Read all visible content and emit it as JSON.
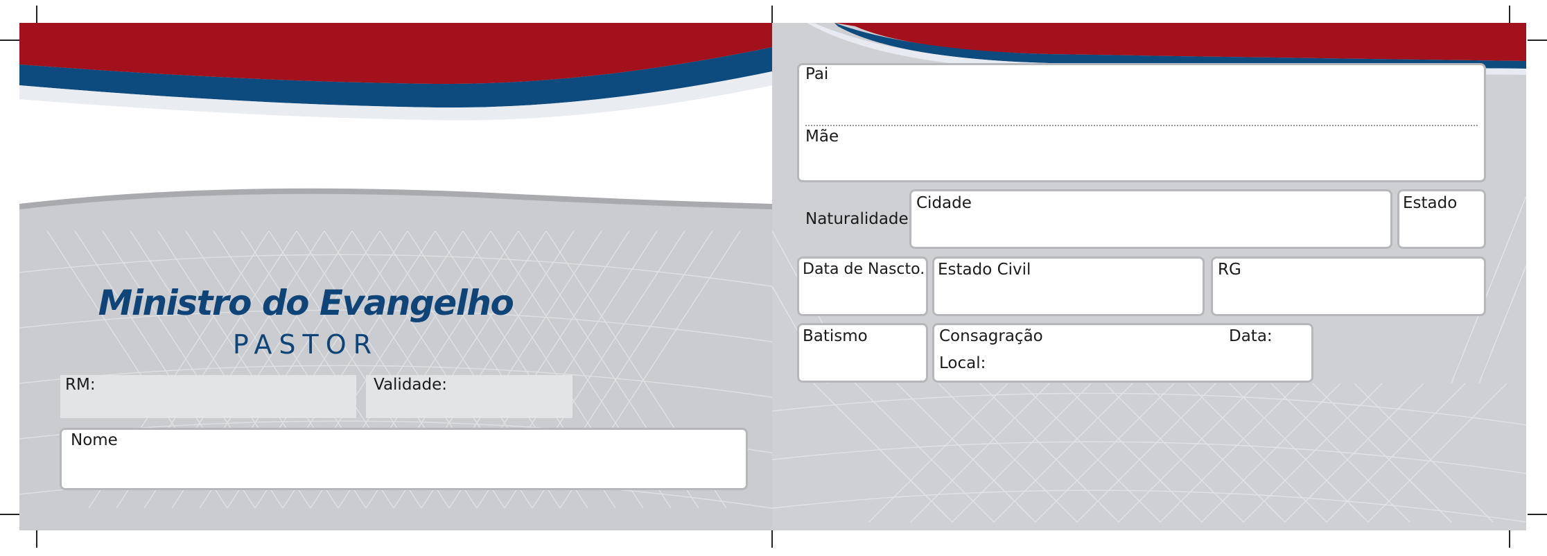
{
  "front": {
    "title": "Ministro do Evangelho",
    "subtitle": "PASTOR",
    "rm_label": "RM:",
    "validade_label": "Validade:",
    "nome_label": "Nome"
  },
  "back": {
    "pai_label": "Pai",
    "mae_label": "Mãe",
    "naturalidade_label": "Naturalidade",
    "cidade_label": "Cidade",
    "estado_label": "Estado",
    "data_nasc_label": "Data de Nascto.",
    "estado_civil_label": "Estado Civil",
    "rg_label": "RG",
    "batismo_label": "Batismo",
    "consagracao_label": "Consagração",
    "data_label": "Data:",
    "local_label": "Local:"
  },
  "colors": {
    "red": "#a3121c",
    "blue": "#0d4a7e",
    "title_blue": "#0f4478",
    "panel_grey": "#cbcccf"
  }
}
